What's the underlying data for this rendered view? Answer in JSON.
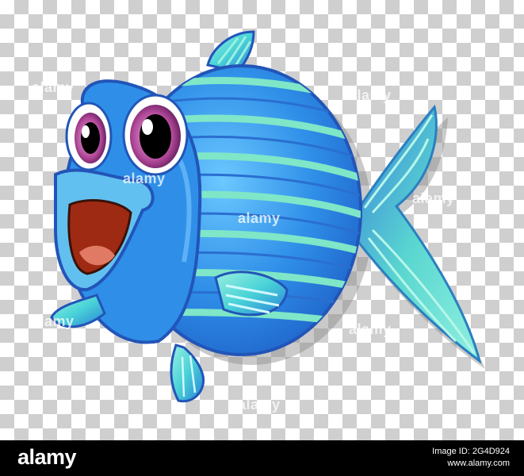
{
  "image": {
    "subject": "cartoon blue striped puffer fish",
    "background": "transparent checkerboard"
  },
  "colors": {
    "body_blue": "#2f8fe8",
    "stripe_green": "#7fe6c8",
    "fin_teal": "#49d3d7",
    "outline": "#2255b8",
    "eye_purple": "#b24a9a",
    "mouth_red": "#9e2a14"
  },
  "watermarks": [
    "alamy",
    "alamy",
    "alamy",
    "alamy",
    "alamy",
    "alamy",
    "alamy",
    "alamy"
  ],
  "footer": {
    "logo": "alamy",
    "image_id_label": "Image ID: 2G4D924",
    "url": "www.alamy.com"
  }
}
